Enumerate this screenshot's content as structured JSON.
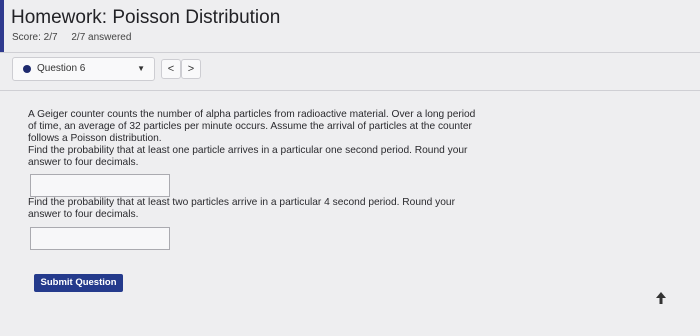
{
  "header": {
    "title": "Homework: Poisson Distribution",
    "score": "Score: 2/7",
    "answered": "2/7 answered"
  },
  "question_nav": {
    "current": "Question 6",
    "prev_symbol": "<",
    "next_symbol": ">"
  },
  "question": {
    "intro": [
      "A Geiger counter counts the number of alpha particles from radioactive material. Over a long period",
      "of time, an average of 32 particles per minute occurs. Assume the arrival of particles at the counter",
      "follows a Poisson distribution."
    ],
    "part1": [
      "Find the probability that at least one particle arrives in a particular one second period. Round your",
      "answer to four decimals."
    ],
    "part2": [
      "Find the probability that at least two particles arrive in a particular 4 second period. Round your",
      "answer to four decimals."
    ],
    "answer1_value": "",
    "answer2_value": ""
  },
  "submit_label": "Submit Question",
  "colors": {
    "accent": "#2f3a8f",
    "submit_bg": "#243a8c",
    "background": "#eeeef0"
  }
}
